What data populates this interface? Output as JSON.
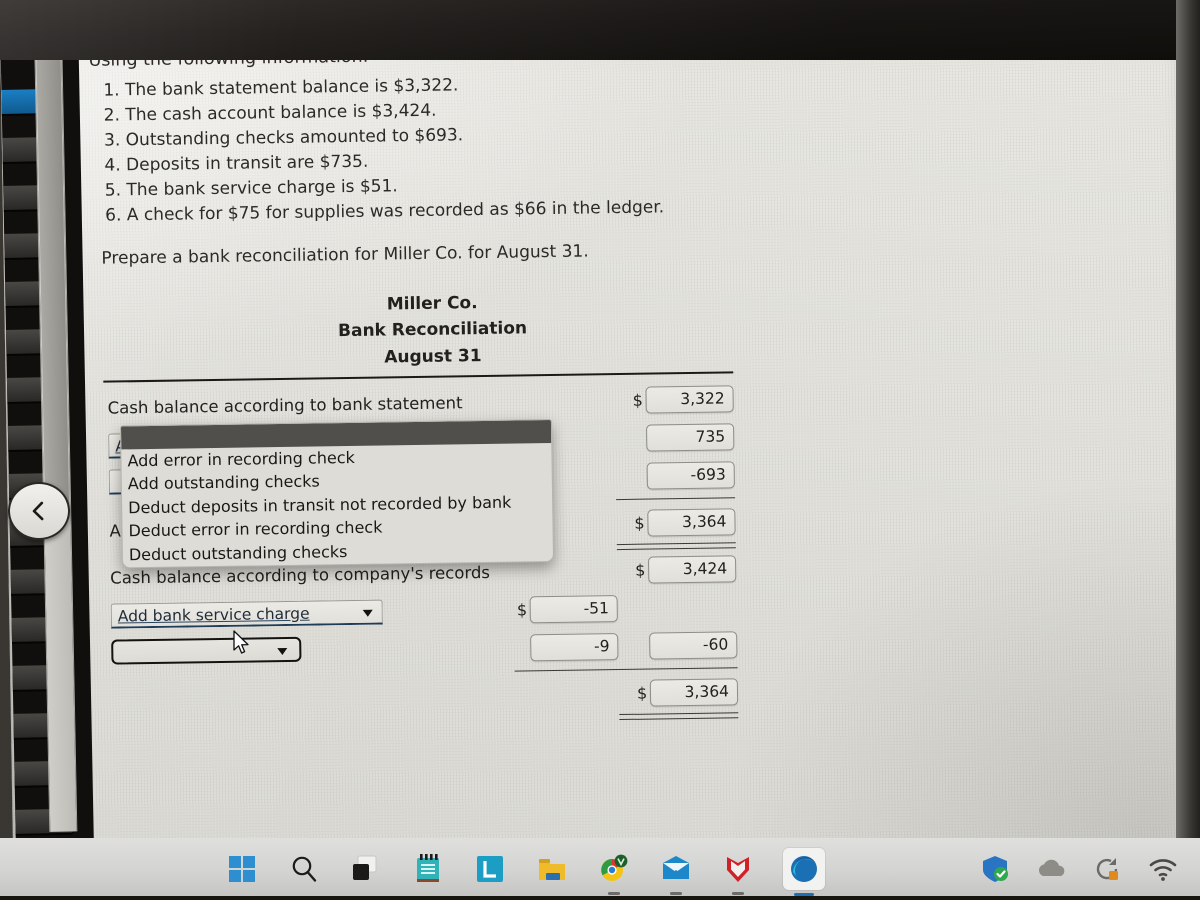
{
  "prompt": {
    "lead": "Using the following information:",
    "items": [
      "The bank statement balance is $3,322.",
      "The cash account balance is $3,424.",
      "Outstanding checks amounted to $693.",
      "Deposits in transit are $735.",
      "The bank service charge is $51.",
      "A check for $75 for supplies was recorded as $66 in the ledger."
    ],
    "closing": "Prepare a bank reconciliation for Miller Co. for August 31."
  },
  "statement": {
    "company": "Miller Co.",
    "title": "Bank Reconciliation",
    "date": "August 31",
    "rows": {
      "bank_label": "Cash balance according to bank statement",
      "bank_dollar": "$",
      "bank_value": "3,322",
      "add1_select": "Add bank service charge",
      "add1_value": "735",
      "add2_select": "",
      "add2_value": "-693",
      "adjusted_label": "Adjusted balance",
      "adjusted_dollar": "$",
      "adjusted_value": "3,364",
      "company_label": "Cash balance according to company's records",
      "company_dollar": "$",
      "company_value": "3,424",
      "ded1_select": "Add bank service charge",
      "ded1_dollar": "$",
      "ded1_inner": "-51",
      "ded2_select": "",
      "ded2_inner": "-9",
      "ded2_outer": "-60",
      "final_dollar": "$",
      "final_value": "3,364"
    }
  },
  "dropdown": {
    "options": [
      "Add error in recording check",
      "Add outstanding checks",
      "Deduct deposits in transit not recorded by bank",
      "Deduct error in recording check",
      "Deduct outstanding checks"
    ]
  },
  "taskbar": {
    "items": [
      {
        "name": "windows-start-icon"
      },
      {
        "name": "search-icon"
      },
      {
        "name": "task-view-icon"
      },
      {
        "name": "notepad-icon"
      },
      {
        "name": "app-l-icon"
      },
      {
        "name": "file-explorer-icon"
      },
      {
        "name": "chrome-icon"
      },
      {
        "name": "mail-icon"
      },
      {
        "name": "mcafee-icon"
      },
      {
        "name": "edge-icon"
      }
    ],
    "tray": [
      {
        "name": "security-shield-icon"
      },
      {
        "name": "onedrive-cloud-icon"
      },
      {
        "name": "update-sync-icon"
      },
      {
        "name": "wifi-icon"
      }
    ]
  },
  "colors": {
    "select_underline": "#1f3c58",
    "page_bg": "#e3e2dc",
    "text": "#23211e"
  }
}
